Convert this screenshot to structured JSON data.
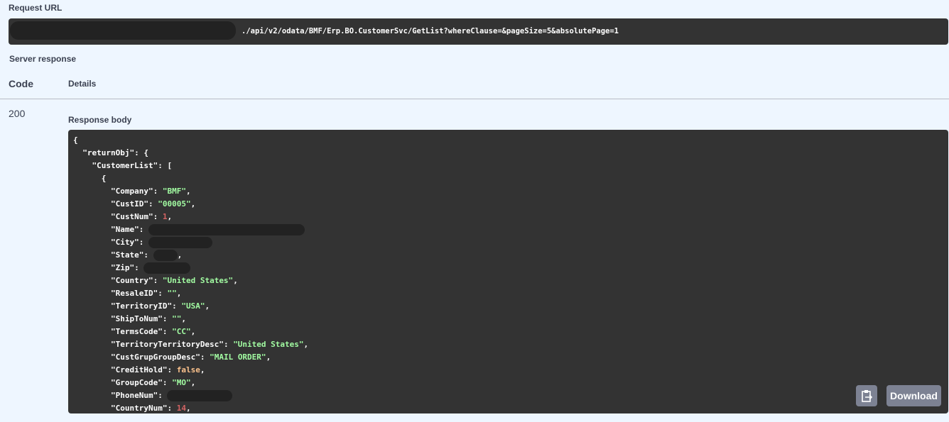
{
  "request_url": {
    "label": "Request URL",
    "value_visible": "./api/v2/odata/BMF/Erp.BO.CustomerSvc/GetList?whereClause=&pageSize=5&absolutePage=1"
  },
  "server_response": {
    "label": "Server response",
    "headers": {
      "code": "Code",
      "details": "Details"
    },
    "code": "200",
    "response_body_label": "Response body",
    "lines": [
      {
        "indent": 0,
        "text": "{"
      },
      {
        "indent": 1,
        "key": "returnObj",
        "open": "{"
      },
      {
        "indent": 2,
        "key": "CustomerList",
        "open": "["
      },
      {
        "indent": 3,
        "text": "{"
      },
      {
        "indent": 4,
        "key": "Company",
        "value": "\"BMF\"",
        "type": "str"
      },
      {
        "indent": 4,
        "key": "CustID",
        "value": "\"00005\"",
        "type": "str"
      },
      {
        "indent": 4,
        "key": "CustNum",
        "value": "1",
        "type": "num"
      },
      {
        "indent": 4,
        "key": "Name",
        "redacted": 220
      },
      {
        "indent": 4,
        "key": "City",
        "redacted": 90
      },
      {
        "indent": 4,
        "key": "State",
        "redacted": 34,
        "trail": ","
      },
      {
        "indent": 4,
        "key": "Zip",
        "redacted": 66
      },
      {
        "indent": 4,
        "key": "Country",
        "value": "\"United States\"",
        "type": "str"
      },
      {
        "indent": 4,
        "key": "ResaleID",
        "value": "\"\"",
        "type": "str"
      },
      {
        "indent": 4,
        "key": "TerritoryID",
        "value": "\"USA\"",
        "type": "str"
      },
      {
        "indent": 4,
        "key": "ShipToNum",
        "value": "\"\"",
        "type": "str"
      },
      {
        "indent": 4,
        "key": "TermsCode",
        "value": "\"CC\"",
        "type": "str"
      },
      {
        "indent": 4,
        "key": "TerritoryTerritoryDesc",
        "value": "\"United States\"",
        "type": "str"
      },
      {
        "indent": 4,
        "key": "CustGrupGroupDesc",
        "value": "\"MAIL ORDER\"",
        "type": "str"
      },
      {
        "indent": 4,
        "key": "CreditHold",
        "value": "false",
        "type": "bool"
      },
      {
        "indent": 4,
        "key": "GroupCode",
        "value": "\"MO\"",
        "type": "str"
      },
      {
        "indent": 4,
        "key": "PhoneNum",
        "redacted": 92
      },
      {
        "indent": 4,
        "key": "CountryNum",
        "value": "14",
        "type": "num"
      }
    ]
  },
  "buttons": {
    "copy_icon": "clipboard-icon",
    "download": "Download"
  }
}
